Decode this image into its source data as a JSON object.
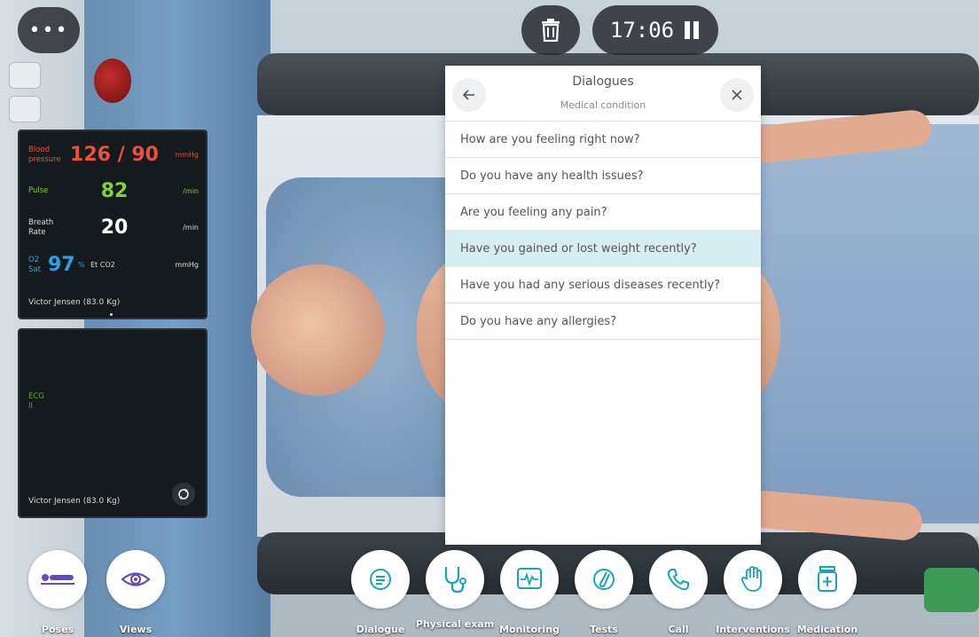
{
  "timer": {
    "time": "17:06"
  },
  "vitals": {
    "bp": {
      "label": "Blood pressure",
      "value": "126 / 90",
      "unit": "mmHg"
    },
    "pulse": {
      "label": "Pulse",
      "value": "82",
      "unit": "/min"
    },
    "breath": {
      "label": "Breath Rate",
      "value": "20",
      "unit": "/min"
    },
    "o2": {
      "label": "O2 Sat",
      "value": "97",
      "unit": "%",
      "et_label": "Et CO2",
      "et_unit": "mmHg"
    },
    "patient": "Victor Jensen (83.0 Kg)"
  },
  "ecg": {
    "label": "ECG II",
    "patient": "Victor Jensen (83.0 Kg)"
  },
  "dialog": {
    "title": "Dialogues",
    "subtitle": "Medical condition",
    "items": [
      "How are you feeling right now?",
      "Do you have any health issues?",
      "Are you feeling any pain?",
      "Have you gained or lost weight recently?",
      "Have you had any serious diseases recently?",
      "Do you have any allergies?"
    ],
    "selected_index": 3
  },
  "toolbar": {
    "poses": "Poses",
    "views": "Views",
    "dialogue": "Dialogue",
    "physical": "Physical exam",
    "monitoring": "Monitoring",
    "tests": "Tests",
    "call": "Call",
    "interventions": "Interventions",
    "medication": "Medication"
  },
  "colors": {
    "bp": "#e8523a",
    "pulse": "#7ed23a",
    "o2": "#2aa3e6",
    "accent": "#16a6b6",
    "selected_row": "#d6eef2"
  },
  "icons": {
    "menu": "more-dots-icon",
    "trash": "trash-icon",
    "pause": "pause-icon",
    "back": "arrow-left-icon",
    "close": "close-icon"
  }
}
